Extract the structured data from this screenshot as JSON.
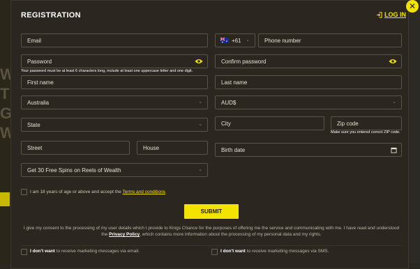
{
  "background": {
    "letters": [
      "W",
      "T",
      "G",
      "W"
    ]
  },
  "modal": {
    "title": "REGISTRATION",
    "login_label": "LOG IN",
    "close_glyph": "✕"
  },
  "form": {
    "email": {
      "placeholder": "Email"
    },
    "phone": {
      "country_code": "+61",
      "flag": "australia-flag",
      "placeholder": "Phone number"
    },
    "password": {
      "placeholder": "Password",
      "hint": "Your password must be at least 6 characters long, include at least one uppercase letter and one digit."
    },
    "confirm_password": {
      "placeholder": "Confirm password"
    },
    "first_name": {
      "placeholder": "First name"
    },
    "last_name": {
      "placeholder": "Last name"
    },
    "country": {
      "value": "Australia"
    },
    "currency": {
      "value": "AUD$"
    },
    "state": {
      "value": "State"
    },
    "city": {
      "placeholder": "City"
    },
    "zip": {
      "placeholder": "Zip code",
      "hint": "Make sure you entered correct ZIP code."
    },
    "street": {
      "placeholder": "Street"
    },
    "house": {
      "placeholder": "House"
    },
    "birth_date": {
      "placeholder": "Birth date"
    },
    "bonus": {
      "value": "Get 30 Free Spins on Reels of Wealth"
    },
    "age_terms": {
      "text": "I am 18 years of age or above and accept the",
      "link": "Terms and conditions"
    },
    "submit_label": "SUBMIT",
    "consent": {
      "text_before": "I give my consent to the processing of my user details which I provide to Kings Chance for the purposes of offering me the service and communicating with me. I have read and understood the",
      "link": "Privacy Policy",
      "text_after": ", which contains more information about the processing of my personal data and my rights."
    },
    "email_optout": {
      "strong": "I don't want",
      "rest": "to receive marketing messages via email."
    },
    "sms_optout": {
      "strong": "I don't want",
      "rest": "to receive marketing messages via SMS."
    }
  },
  "colors": {
    "accent": "#f2e400",
    "modal_bg": "#2b2720",
    "border": "#5a5446"
  }
}
